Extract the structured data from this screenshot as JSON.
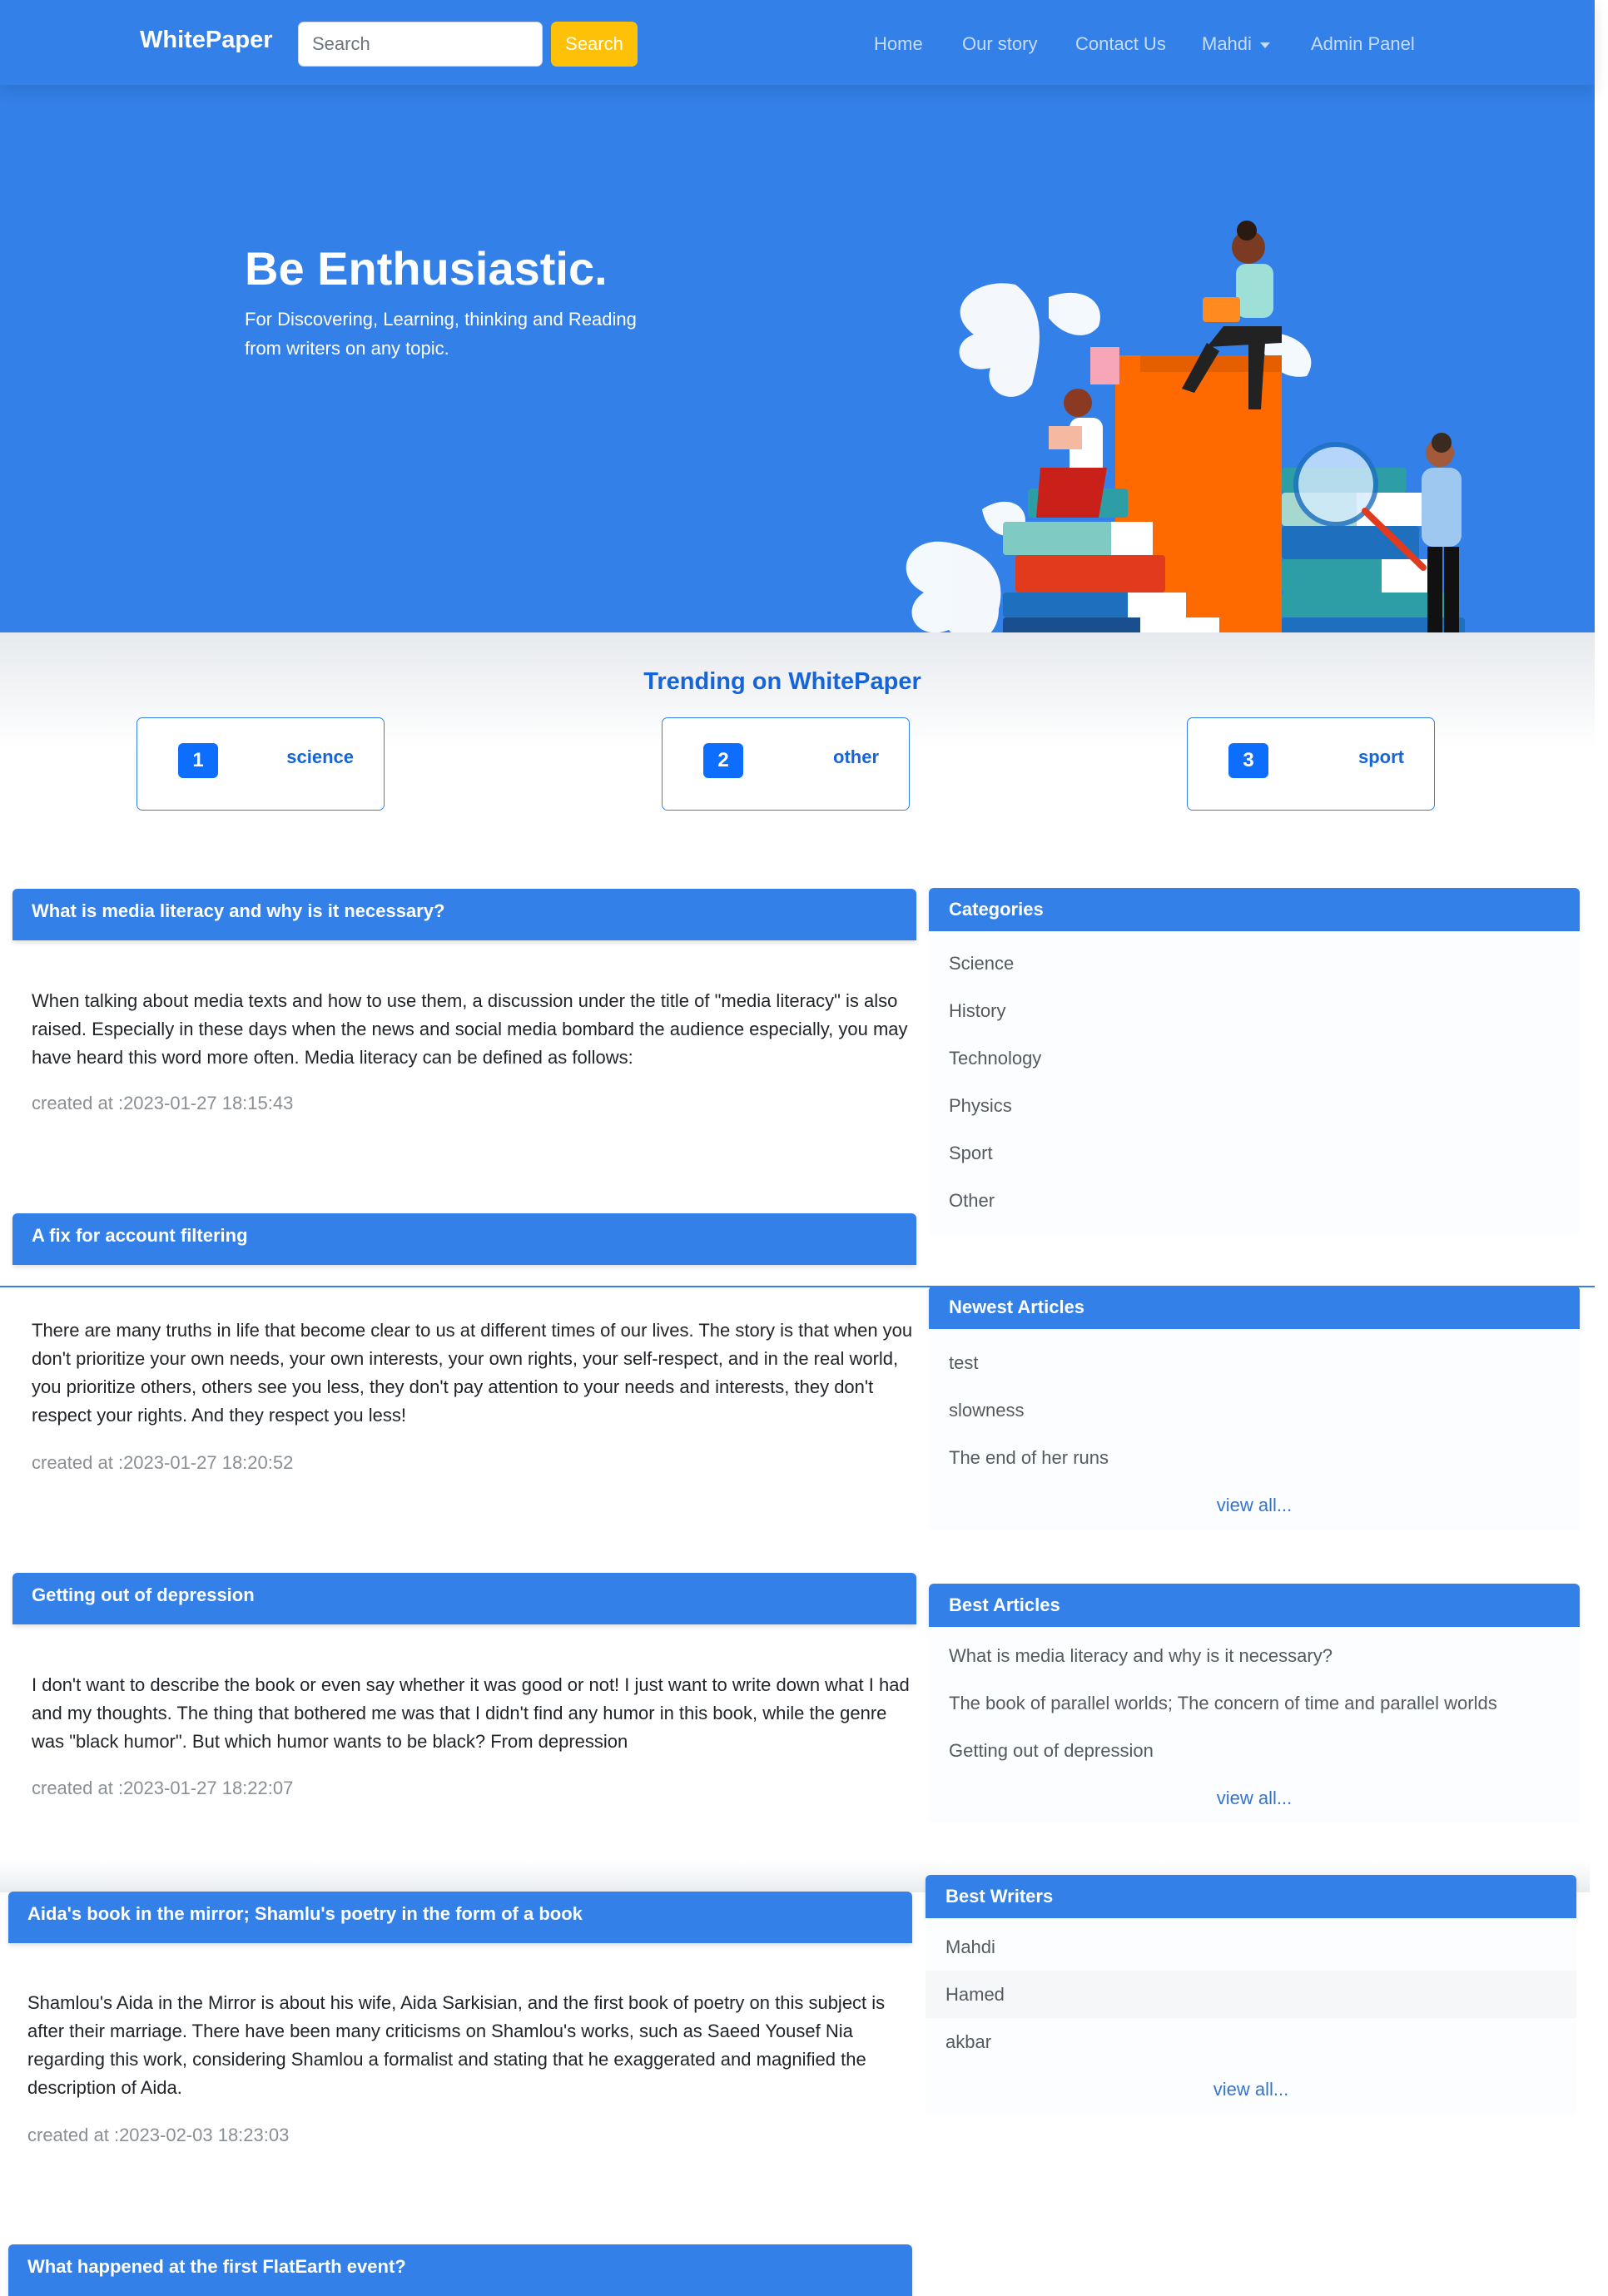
{
  "nav": {
    "brand": "WhitePaper",
    "search_placeholder": "Search",
    "search_button": "Search",
    "links": {
      "home": "Home",
      "story": "Our story",
      "contact": "Contact Us",
      "user": "Mahdi",
      "admin": "Admin Panel"
    }
  },
  "hero": {
    "title": "Be Enthusiastic.",
    "subtitle": "For Discovering, Learning, thinking and Reading from writers on any topic."
  },
  "trending": {
    "title": "Trending on WhitePaper",
    "items": [
      {
        "rank": "1",
        "name": "science"
      },
      {
        "rank": "2",
        "name": "other"
      },
      {
        "rank": "3",
        "name": "sport"
      }
    ]
  },
  "articles": [
    {
      "title": "What is media literacy and why is it necessary?",
      "body": "When talking about media texts and how to use them, a discussion under the title of \"media literacy\" is also raised. Especially in these days when the news and social media bombard the audience especially, you may have heard this word more often. Media literacy can be defined as follows:",
      "date": "created at :2023-01-27 18:15:43"
    },
    {
      "title": "A fix for account filtering",
      "body": "There are many truths in life that become clear to us at different times of our lives. The story is that when you don't prioritize your own needs, your own interests, your own rights, your self-respect, and in the real world, you prioritize others, others see you less, they don't pay attention to your needs and interests, they don't respect your rights. And they respect you less!",
      "date": "created at :2023-01-27 18:20:52"
    },
    {
      "title": "Getting out of depression",
      "body": "I don't want to describe the book or even say whether it was good or not! I just want to write down what I had and my thoughts. The thing that bothered me was that I didn't find any humor in this book, while the genre was \"black humor\". But which humor wants to be black? From depression",
      "date": "created at :2023-01-27 18:22:07"
    },
    {
      "title": "Aida's book in the mirror; Shamlu's poetry in the form of a book",
      "body": "Shamlou's Aida in the Mirror is about his wife, Aida Sarkisian, and the first book of poetry on this subject is after their marriage. There have been many criticisms on Shamlou's works, such as Saeed Yousef Nia regarding this work, considering Shamlou a formalist and stating that he exaggerated and magnified the description of Aida.",
      "date": "created at :2023-02-03 18:23:03"
    },
    {
      "title": "What happened at the first FlatEarth event?"
    }
  ],
  "sidebar": {
    "categories": {
      "title": "Categories",
      "items": [
        "Science",
        "History",
        "Technology",
        "Physics",
        "Sport",
        "Other"
      ]
    },
    "newest": {
      "title": "Newest Articles",
      "items": [
        "test",
        "slowness",
        "The end of her runs"
      ],
      "view_all": "view all..."
    },
    "best_articles": {
      "title": "Best Articles",
      "items": [
        "What is media literacy and why is it necessary?",
        "The book of parallel worlds; The concern of time and parallel worlds",
        "Getting out of depression"
      ],
      "view_all": "view all..."
    },
    "best_writers": {
      "title": "Best Writers",
      "items": [
        "Mahdi",
        "Hamed",
        "akbar"
      ],
      "view_all": "view all..."
    }
  },
  "colors": {
    "primary": "#3280e8",
    "accent_yellow": "#ffc107",
    "rank_badge": "#0d6efd",
    "illustration_orange": "#ff6a00"
  }
}
